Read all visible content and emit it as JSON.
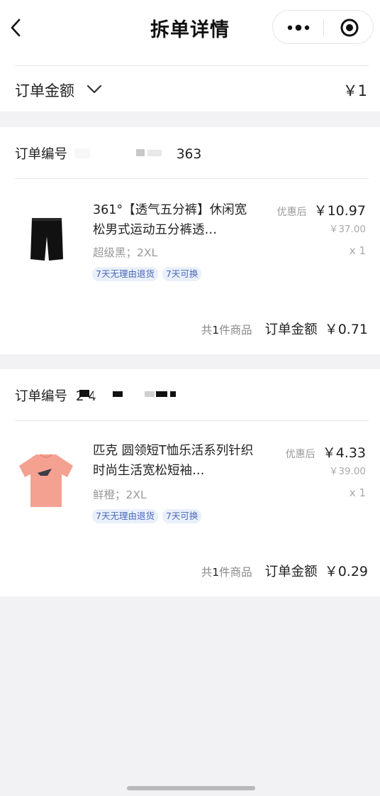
{
  "header": {
    "title": "拆单详情",
    "back_icon": "chevron-left-icon",
    "more_icon": "more-dots-icon",
    "close_icon": "target-close-icon"
  },
  "summary_card": {
    "label": "订单金额",
    "value": "￥1",
    "expand_icon": "chevron-down-icon"
  },
  "orders": [
    {
      "order_no_label": "订单编号",
      "order_no_visible": "363",
      "product": {
        "title": "361°【透气五分裤】休闲宽松男式运动五分裤透…",
        "spec": "超级黑；2XL",
        "tags": [
          "7天无理由退货",
          "7天可换"
        ],
        "promo_label": "优惠后",
        "price_now": "￥10.97",
        "price_original": "￥37.00",
        "quantity": "x 1",
        "image_icon": "black-shorts-image"
      },
      "footer": {
        "count_prefix": "共",
        "count": "1",
        "count_suffix": "件商品",
        "amount_label": "订单金额",
        "amount_value": "￥0.71"
      }
    },
    {
      "order_no_label": "订单编号",
      "order_no_visible": "2      4",
      "product": {
        "title": "匹克 圆领短T恤乐活系列针织时尚生活宽松短袖…",
        "spec": "鲜橙；2XL",
        "tags": [
          "7天无理由退货",
          "7天可换"
        ],
        "promo_label": "优惠后",
        "price_now": "￥4.33",
        "price_original": "￥39.00",
        "quantity": "x 1",
        "image_icon": "orange-tshirt-image"
      },
      "footer": {
        "count_prefix": "共",
        "count": "1",
        "count_suffix": "件商品",
        "amount_label": "订单金额",
        "amount_value": "￥0.29"
      }
    }
  ],
  "colors": {
    "page_bg": "#f2f2f4",
    "tag_text": "#4a68b8",
    "tag_bg": "#eaf0fb",
    "tshirt": "#f4a192"
  }
}
